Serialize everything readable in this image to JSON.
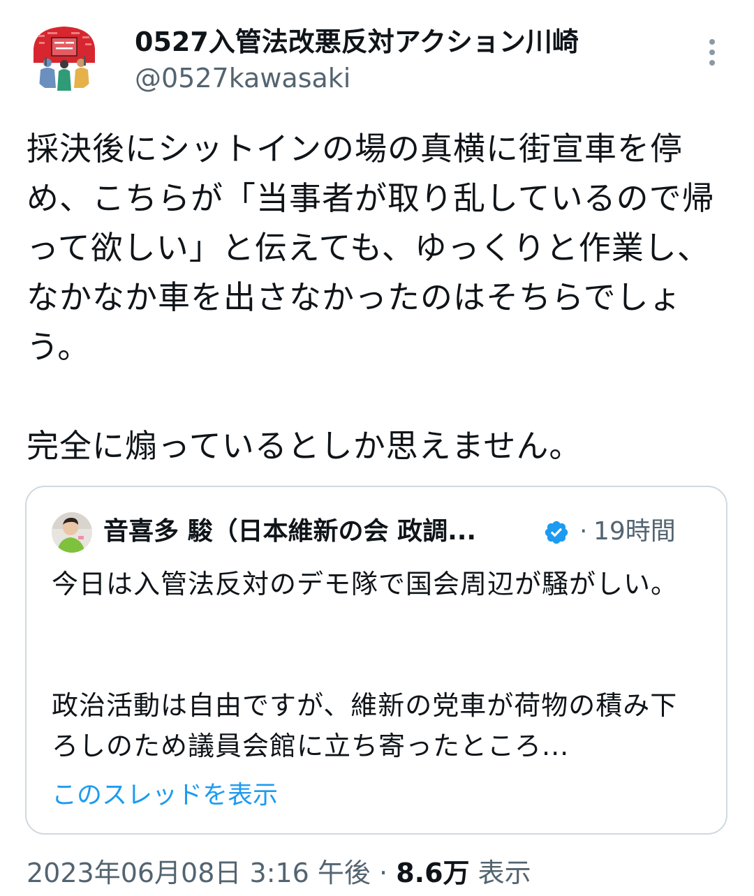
{
  "author": {
    "display_name": "0527入管法改悪反対アクション川崎",
    "handle": "@0527kawasaki",
    "avatar_icon": "protest-avatar-icon"
  },
  "tweet": {
    "text": "採決後にシットインの場の真横に街宣車を停め、こちらが「当事者が取り乱しているので帰って欲しい」と伝えても、ゆっくりと作業し、なかなか車を出さなかったのはそちらでしょう。\n\n完全に煽っているとしか思えません。"
  },
  "quote": {
    "display_name": "音喜多 駿（日本維新の会 政調...",
    "verified": true,
    "separator": "·",
    "time": "19時間",
    "text": "今日は入管法反対のデモ隊で国会周辺が騒がしい。\n\n\n政治活動は自由ですが、維新の党車が荷物の積み下ろしのため議員会館に立ち寄ったところ...",
    "show_thread": "このスレッドを表示"
  },
  "meta": {
    "date": "2023年06月08日",
    "time": "3:16 午後",
    "separator": "·",
    "views_count": "8.6万",
    "views_label": "表示"
  },
  "colors": {
    "text_primary": "#0f1419",
    "text_secondary": "#536471",
    "link": "#1d9bf0",
    "border": "#cfd9de",
    "verified": "#1d9bf0"
  }
}
